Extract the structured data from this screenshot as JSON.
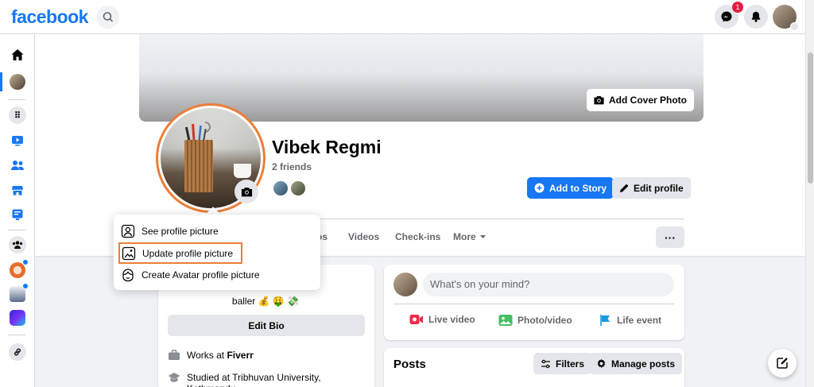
{
  "topbar": {
    "logo": "facebook",
    "messenger_badge": "1"
  },
  "profile": {
    "name": "Vibek Regmi",
    "friends_count": "2 friends",
    "add_cover_label": "Add Cover Photo",
    "add_story_label": "Add to Story",
    "edit_profile_label": "Edit profile"
  },
  "tabs": {
    "photos_partial": "os",
    "videos": "Videos",
    "checkins": "Check-ins",
    "more": "More",
    "more_options": "···"
  },
  "menu": {
    "see_profile_picture": "See profile picture",
    "update_profile_picture": "Update profile picture",
    "create_avatar": "Create Avatar profile picture"
  },
  "intro": {
    "bio": "baller 💰 🤑 💸",
    "edit_bio": "Edit Bio",
    "works_at_prefix": "Works at ",
    "works_at_company": "Fiverr",
    "studied_at": "Studied at Tribhuvan University, Kathmandu,"
  },
  "composer": {
    "placeholder": "What's on your mind?",
    "live_video": "Live video",
    "photo_video": "Photo/video",
    "life_event": "Life event"
  },
  "posts": {
    "title": "Posts",
    "filters": "Filters",
    "manage_posts": "Manage posts"
  },
  "colors": {
    "brand": "#1877f2",
    "highlight_border": "#ec7d38",
    "badge": "#e41e3f"
  }
}
